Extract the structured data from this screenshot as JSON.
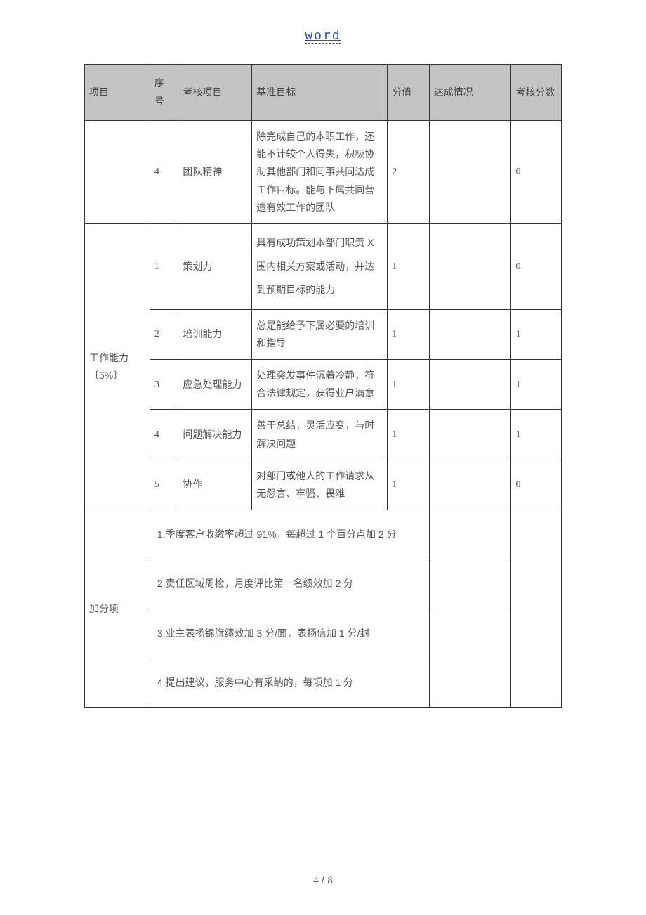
{
  "header": {
    "link": "word"
  },
  "columns": {
    "project": "项目",
    "seq": "序号",
    "item": "考核项目",
    "criteria": "基准目标",
    "score": "分值",
    "status": "达成情况",
    "result": "考核分数"
  },
  "row_team": {
    "seq": "4",
    "item": "团队精神",
    "criteria": "除完成自己的本职工作，还能不计较个人得失，积极协助其他部门和同事共同达成工作目标。能与下属共同营造有效工作的团队",
    "score": "2",
    "status": "",
    "result": "0"
  },
  "section_ability": {
    "title": "工作能力〔5%〕",
    "rows": [
      {
        "seq": "1",
        "item": "策划力",
        "criteria": "具有成功策划本部门职责 X 围内相关方案或活动，并达到预期目标的能力",
        "score": "1",
        "status": "",
        "result": "0"
      },
      {
        "seq": "2",
        "item": "培训能力",
        "criteria": "总是能给予下属必要的培训和指导",
        "score": "1",
        "status": "",
        "result": "1"
      },
      {
        "seq": "3",
        "item": "应急处理能力",
        "criteria": "处理突发事件沉着冷静，符合法律规定，获得业户满意",
        "score": "1",
        "status": "",
        "result": "1"
      },
      {
        "seq": "4",
        "item": "问题解决能力",
        "criteria": "善于总结，灵活应变，与时解决问题",
        "score": "1",
        "status": "",
        "result": "1"
      },
      {
        "seq": "5",
        "item": "协作",
        "criteria": "对部门或他人的工作请求从无怨言、牢骚、畏难",
        "score": "1",
        "status": "",
        "result": "0"
      }
    ]
  },
  "section_bonus": {
    "title": "加分项",
    "items": [
      "1.季度客户收缴率超过 91%，每超过 1 个百分点加 2 分",
      "2.责任区域周检，月度评比第一名绩效加 2 分",
      "3.业主表扬锦旗绩效加 3 分/面，表扬信加 1 分/封",
      "4.提出建议，服务中心有采纳的，每项加 1 分"
    ]
  },
  "footer": {
    "page": "4",
    "sep": " / ",
    "total": "8"
  }
}
